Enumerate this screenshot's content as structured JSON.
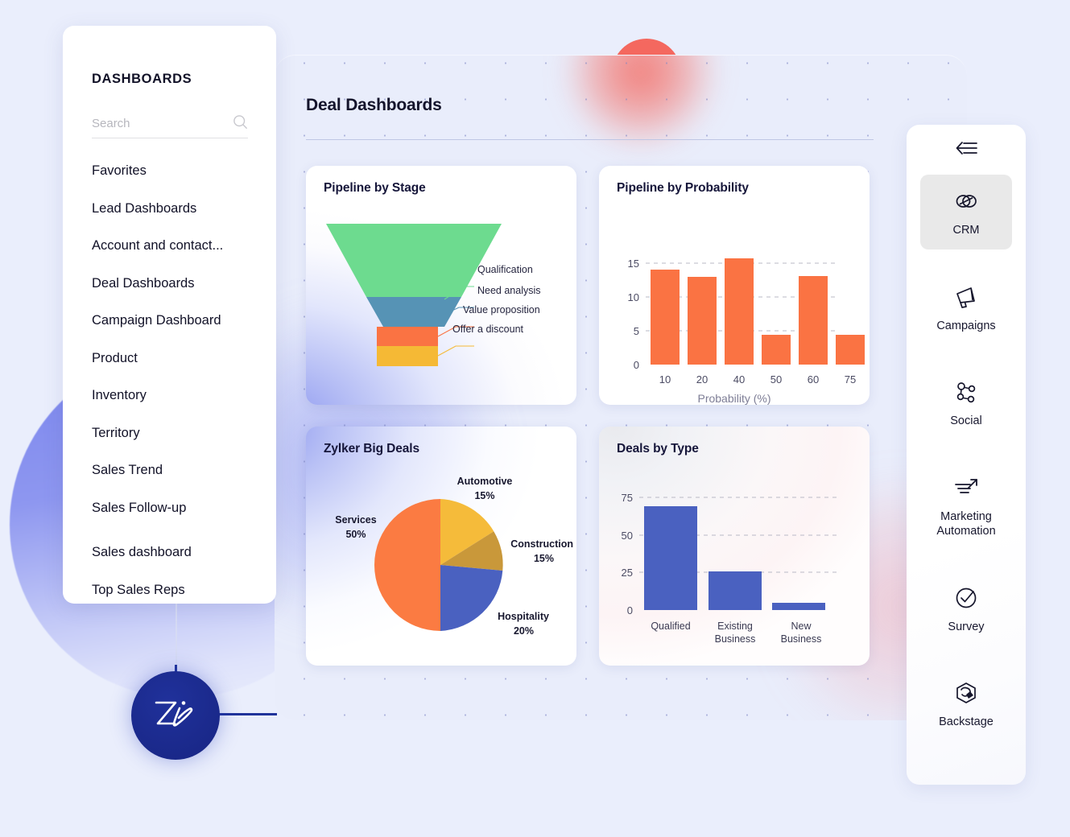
{
  "sidebar": {
    "title": "DASHBOARDS",
    "search": {
      "placeholder": "Search",
      "value": "",
      "icon": "search-icon"
    },
    "items": [
      {
        "label": "Favorites"
      },
      {
        "label": "Lead Dashboards"
      },
      {
        "label": "Account and contact..."
      },
      {
        "label": "Deal Dashboards"
      },
      {
        "label": "Campaign Dashboard"
      },
      {
        "label": "Product"
      },
      {
        "label": "Inventory"
      },
      {
        "label": "Territory"
      },
      {
        "label": "Sales Trend"
      },
      {
        "label": "Sales Follow-up"
      },
      {
        "label": "Sales dashboard"
      },
      {
        "label": "Top Sales Reps"
      }
    ]
  },
  "main": {
    "title": "Deal Dashboards"
  },
  "rail": {
    "collapse_icon": "collapse-left-icon",
    "items": [
      {
        "label": "CRM",
        "icon": "crm-links-icon",
        "active": true
      },
      {
        "label": "Campaigns",
        "icon": "megaphone-icon",
        "active": false
      },
      {
        "label": "Social",
        "icon": "share-network-icon",
        "active": false
      },
      {
        "label": "Marketing Automation",
        "icon": "trend-arrow-icon",
        "active": false
      },
      {
        "label": "Survey",
        "icon": "check-circle-icon",
        "active": false
      },
      {
        "label": "Backstage",
        "icon": "hexagon-box-icon",
        "active": false
      }
    ]
  },
  "zia": {
    "label": "Zia",
    "icon": "zia-logo-icon"
  },
  "colors": {
    "page_bg": "#eaeefc",
    "panel_bg": "#e9edfb",
    "accent_blue": "#4a61c0",
    "accent_orange": "#fa7343",
    "brand_navy": "#20319b",
    "funnel_green": "#6ddb8f",
    "funnel_blue": "#5693b5",
    "funnel_orange": "#fa7343",
    "funnel_yellow": "#f5b935",
    "pie_yellow": "#f5bb3a",
    "pie_gold": "#c9983a",
    "pie_blue": "#4a61c0",
    "pie_orange": "#fb7b42",
    "bar_blue": "#4a61c0"
  },
  "chart_data": [
    {
      "type": "funnel",
      "title": "Pipeline by Stage",
      "categories": [
        "Qualification",
        "Need analysis",
        "Value proposition",
        "Offer a discount"
      ],
      "values": [
        100,
        46,
        31,
        31
      ],
      "colors": [
        "#6ddb8f",
        "#5693b5",
        "#fa7343",
        "#f5b935"
      ],
      "legend": "callout-right"
    },
    {
      "type": "bar",
      "title": "Pipeline by Probability",
      "categories": [
        "10",
        "20",
        "40",
        "50",
        "60",
        "75"
      ],
      "values": [
        14,
        13,
        15.7,
        4.4,
        13.1,
        4.4
      ],
      "xlabel": "Probability (%)",
      "ylabel": "",
      "yticks": [
        0,
        5,
        10,
        15
      ],
      "ylim": [
        0,
        17
      ],
      "grid": true,
      "color": "#fa7343"
    },
    {
      "type": "pie",
      "title": "Zylker Big Deals",
      "labels": [
        "Automotive",
        "Construction",
        "Hospitality",
        "Services"
      ],
      "values": [
        15,
        15,
        20,
        50
      ],
      "value_labels": [
        "15%",
        "15%",
        "20%",
        "50%"
      ],
      "colors": [
        "#f5bb3a",
        "#c9983a",
        "#4a61c0",
        "#fb7b42"
      ],
      "legend": "outside-labels"
    },
    {
      "type": "bar",
      "title": "Deals by Type",
      "categories": [
        "Qualified",
        "Existing Business",
        "New Business"
      ],
      "values": [
        69,
        26,
        5
      ],
      "xlabel": "",
      "ylabel": "",
      "yticks": [
        0,
        25,
        50,
        75
      ],
      "ylim": [
        0,
        80
      ],
      "grid": true,
      "color": "#4a61c0"
    }
  ]
}
